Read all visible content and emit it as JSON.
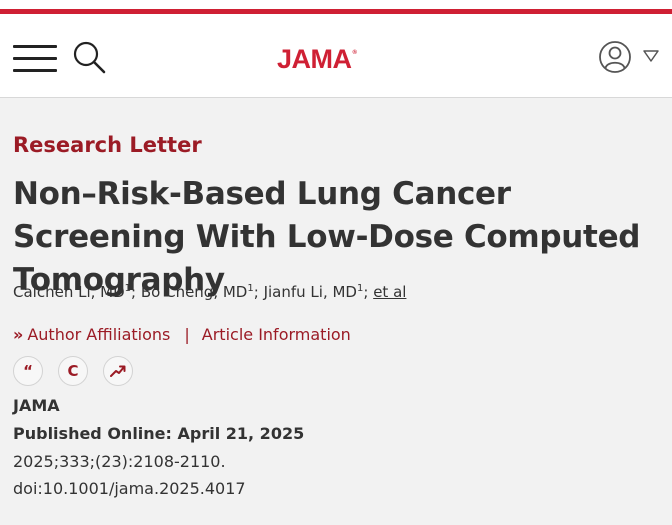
{
  "header": {
    "logo_text": "JAMA",
    "logo_mark": "®",
    "icons": {
      "menu": "menu-icon",
      "search": "search-icon",
      "account": "account-icon",
      "account_menu": "caret-down-icon"
    }
  },
  "article": {
    "type_label": "Research Letter",
    "title": "Non–Risk-Based Lung Cancer Screening With Low-Dose Computed Tomography",
    "authors": [
      {
        "name": "Caichen Li, MD",
        "affiliation": "1"
      },
      {
        "name": "Bo Cheng, MD",
        "affiliation": "1"
      },
      {
        "name": "Jianfu Li, MD",
        "affiliation": "1"
      }
    ],
    "et_al": "et al",
    "links": {
      "affiliations_chevron": "»",
      "affiliations": "Author Affiliations",
      "separator": "|",
      "article_info": "Article Information"
    },
    "tools": {
      "quote_glyph": "“",
      "cite_glyph": "C",
      "metrics_icon": "trending-up-icon"
    },
    "journal": "JAMA",
    "published": "Published Online: April 21, 2025",
    "citation": "2025;333;(23):2108-2110.",
    "doi": "doi:10.1001/jama.2025.4017"
  },
  "colors": {
    "brand_red": "#cf2034",
    "accent_maroon": "#9b1b25",
    "text": "#333333",
    "page_bg": "#f2f2f2",
    "header_bg": "#ffffff"
  }
}
